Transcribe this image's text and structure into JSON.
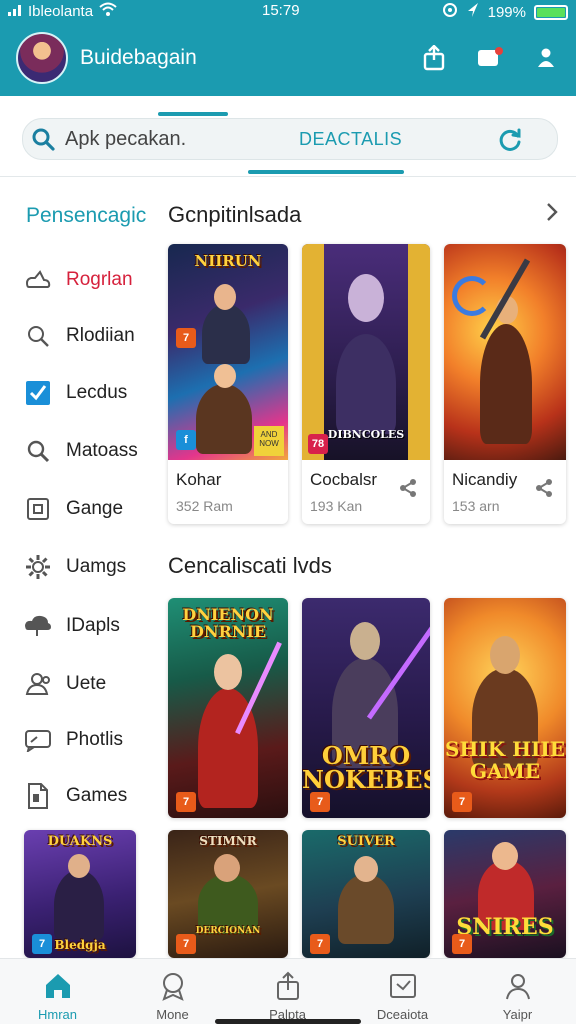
{
  "status_bar": {
    "carrier": "Ibleolanta",
    "time": "15:79",
    "battery": "199%",
    "battery_level": 0.99,
    "icons": [
      "signal-icon",
      "wifi-icon",
      "location-icon",
      "navigation-icon",
      "battery-icon"
    ]
  },
  "app_bar": {
    "title": "Buidebagain",
    "icons": [
      "share-icon",
      "notification-icon",
      "profile-icon"
    ],
    "accent_color": "#1b9bb0"
  },
  "search": {
    "placeholder": "Apk pecakan.",
    "tab_label": "DEACTALIS"
  },
  "sidebar": {
    "heading": "Pensencagic",
    "items": [
      {
        "label": "Rogrlan",
        "icon": "cloud-icon",
        "active": true
      },
      {
        "label": "Rlodiian",
        "icon": "search-icon"
      },
      {
        "label": "Lecdus",
        "icon": "checkbox-icon"
      },
      {
        "label": "Matoass",
        "icon": "search-icon"
      },
      {
        "label": "Gange",
        "icon": "square-icon"
      },
      {
        "label": "Uamgs",
        "icon": "gear-icon"
      },
      {
        "label": "IDapls",
        "icon": "cloud-icon"
      },
      {
        "label": "Uete",
        "icon": "user-icon"
      },
      {
        "label": "Photlis",
        "icon": "message-icon"
      },
      {
        "label": "Games",
        "icon": "document-icon"
      }
    ]
  },
  "section1": {
    "title": "Gcnpitinlsada",
    "cards": [
      {
        "art_title": "NIIRUN",
        "name": "Kohar",
        "meta": "352 Ram",
        "badge": "7",
        "badge2": "AND NOW"
      },
      {
        "art_title": "DIBNCOLES",
        "name": "Cocbalsr",
        "meta": "193 Kan",
        "badge": "78"
      },
      {
        "art_title": "",
        "name": "Nicandiy",
        "meta": "153 arn",
        "badge": ""
      }
    ]
  },
  "section2": {
    "title": "Cencaliscati lvds",
    "cards": [
      {
        "art_title": "DNIENON DNRNIE",
        "badge": "7"
      },
      {
        "art_title": "OMRO NOKEBES",
        "badge": "7"
      },
      {
        "art_title": "SHIK HIIE GAME",
        "badge": "7"
      }
    ]
  },
  "section3": {
    "cards": [
      {
        "art_title": "DUAKNS",
        "bottom_title": "Bledgja",
        "badge": "7"
      },
      {
        "art_title": "STIMNR",
        "bottom_title": "DERCIONAN",
        "badge": "7"
      },
      {
        "art_title": "SUIVER",
        "badge": "7"
      },
      {
        "art_title": "SNIRES",
        "badge": "7"
      }
    ]
  },
  "bottom_nav": [
    {
      "label": "Hmran",
      "icon": "home-icon",
      "active": true
    },
    {
      "label": "Mone",
      "icon": "award-icon"
    },
    {
      "label": "Palpta",
      "icon": "share-icon"
    },
    {
      "label": "Dceaiota",
      "icon": "inbox-icon"
    },
    {
      "label": "Yaipr",
      "icon": "profile-icon"
    }
  ]
}
